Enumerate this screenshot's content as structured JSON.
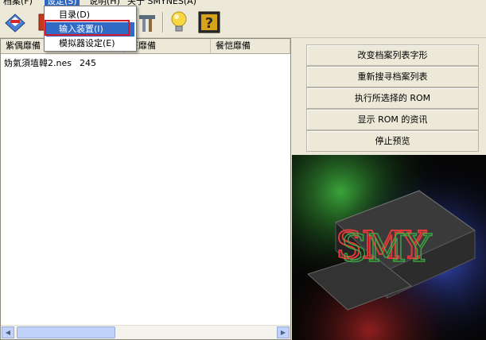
{
  "menubar": {
    "items": [
      "档案(F)",
      "设定(S)",
      "说明(H)",
      "关于 SMYNES(A)"
    ]
  },
  "toolbar": {
    "buttons": [
      {
        "icon": "open-rom-icon"
      },
      {
        "icon": "list-icon"
      },
      {
        "icon": "settings-icon"
      },
      {
        "icon": "tools-icon"
      },
      {
        "icon": "lightbulb-icon"
      },
      {
        "icon": "help-icon"
      }
    ]
  },
  "dropdown": {
    "items": [
      {
        "label": "目录(D)",
        "selected": false
      },
      {
        "label": "输入装置(I)",
        "selected": true
      },
      {
        "label": "模拟器设定(E)",
        "selected": false
      }
    ]
  },
  "list": {
    "columns": [
      "紫偶靡備",
      "芒靡備",
      "餐恺靡備"
    ],
    "rows": [
      {
        "name": "妫氣須埴韓2.nes",
        "value": "245"
      }
    ]
  },
  "actions": [
    "改变档案列表字形",
    "重新搜寻档案列表",
    "执行所选择的 ROM",
    "显示 ROM 的资讯",
    "停止预览"
  ],
  "colors": {
    "menu_highlight": "#316ac5",
    "annotation_red": "#d3192b",
    "window_bg": "#ece9d8"
  }
}
